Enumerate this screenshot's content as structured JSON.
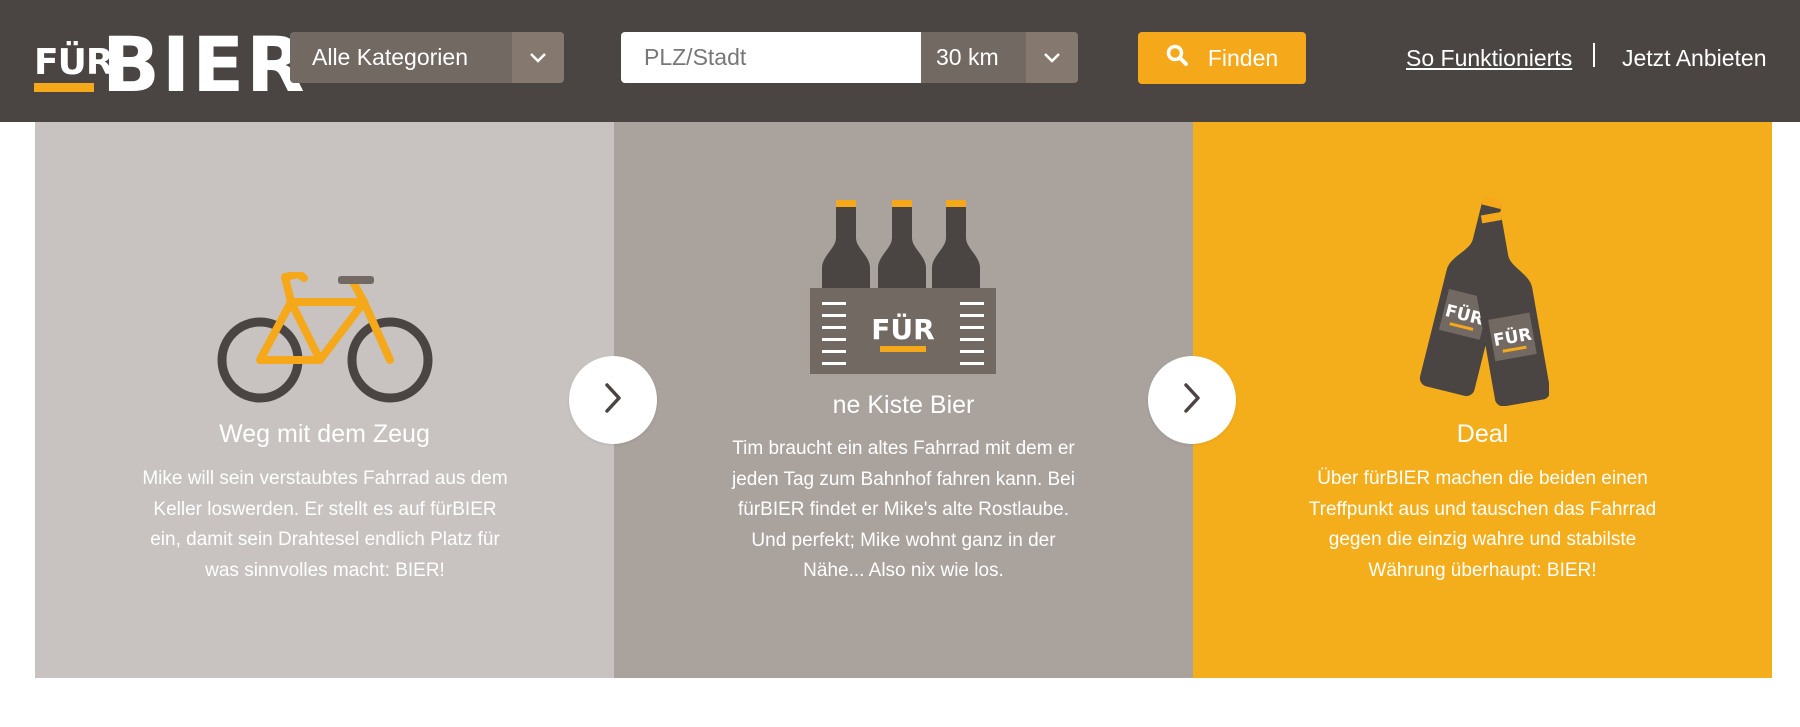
{
  "header": {
    "logo": {
      "part1": "FÜR",
      "part2": "BIER"
    },
    "category_select": {
      "value": "Alle Kategorien",
      "icon": "chevron-down-icon"
    },
    "location_input": {
      "placeholder": "PLZ/Stadt",
      "value": ""
    },
    "radius_select": {
      "value": "30 km",
      "icon": "chevron-down-icon"
    },
    "search_button": {
      "label": "Finden",
      "icon": "search-icon"
    },
    "nav": {
      "how_it_works": "So Funktionierts",
      "offer": "Jetzt Anbieten"
    }
  },
  "steps": [
    {
      "illustration": "bicycle-icon",
      "title": "Weg mit dem Zeug",
      "text": "Mike will sein verstaubtes Fahrrad aus dem Keller loswerden. Er stellt es auf fürBIER ein, damit sein Drahtesel endlich Platz für was sinnvolles macht: BIER!"
    },
    {
      "illustration": "beer-crate-icon",
      "crate_label": "FÜR",
      "title": "ne Kiste Bier",
      "text": "Tim braucht ein altes Fahrrad mit dem er jeden Tag zum Bahnhof fahren kann. Bei fürBIER findet er Mike's alte Rostlaube. Und perfekt; Mike wohnt ganz in der Nähe... Also nix wie los."
    },
    {
      "illustration": "clinking-bottles-icon",
      "bottle_label": "FÜR",
      "title": "Deal",
      "text": "Über fürBIER machen die beiden einen Treffpunkt aus und tauschen das Fahrrad gegen die einzig wahre und stabilste Währung überhaupt: BIER!"
    }
  ],
  "colors": {
    "header_bg": "#4a4542",
    "accent": "#f5a91a",
    "panel1_bg": "#c8c3c0",
    "panel2_bg": "#aaa29d",
    "panel3_bg": "#f5ae1b"
  }
}
